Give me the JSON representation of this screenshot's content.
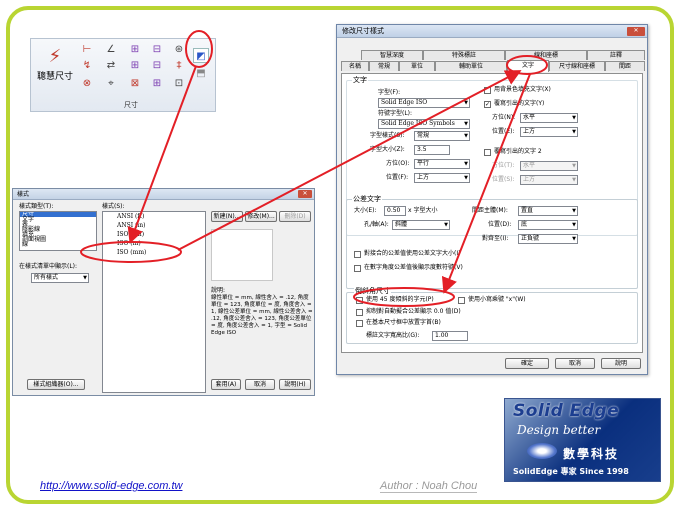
{
  "ribbon": {
    "big_label": "聰慧尺寸",
    "group_label": "尺寸"
  },
  "style_dialog": {
    "title": "樣式",
    "close": "✕",
    "style_type_label": "樣式類型(T):",
    "style_types": [
      "尺寸",
      "文字",
      "表",
      "陰影線",
      "填充",
      "剖面視圖",
      "線"
    ],
    "styles_label": "樣式(S):",
    "styles": [
      "ANSI (ft)",
      "ANSI (in)",
      "ISO (cm)",
      "ISO (m)",
      "ISO (mm)"
    ],
    "show_list_label": "在樣式清單中顯示(L):",
    "show_list_value": "所有樣式",
    "new_button": "新建(N)...",
    "modify_button": "修改(M)...",
    "delete_button": "刪除(D)",
    "description_label": "說明:",
    "description_text": "線性單位 = mm, 線性舍入 = .12, 角度單位 = 123, 角度單位 = 度, 角度舍入 = 1, 線性公差單位 = mm, 線性公差舍入 = .12, 角度公差舍入 = 123, 角度公差單位 = 度, 角度公差舍入 = 1, 字型 = Solid Edge ISO",
    "organizer_button": "樣式組織器(O)...",
    "apply_button": "套用(A)",
    "cancel_button": "取消",
    "help_button": "說明(H)"
  },
  "dim_dialog": {
    "title": "修改尺寸樣式",
    "close": "✕",
    "tabs_row1": [
      "智慧深度",
      "特殊標註",
      "線和座標",
      "註釋"
    ],
    "tabs_row2": [
      "名稱",
      "常規",
      "單位",
      "輔助單位",
      "文字",
      "尺寸線和座標",
      "間距"
    ],
    "text_group": "文字",
    "font_label": "字型(F):",
    "font_value": "Solid Edge ISO",
    "symbol_font_label": "符號字型(L):",
    "symbol_font_value": "Solid Edge ISO Symbols",
    "font_style_label": "字型樣式(S):",
    "font_style_value": "常規",
    "font_size_label": "字型大小(Z):",
    "font_size_value": "3.5",
    "bg_color_label": "用背景色填充文字(X)",
    "override_leader_label": "覆寫引出的文字(Y)",
    "orient1_label": "方位(N):",
    "orient1_value": "水平",
    "pos1_label": "位置(E):",
    "pos1_value": "上方",
    "orient2_label": "方位(O):",
    "orient2_value": "平行",
    "pos2_label": "位置(F):",
    "pos2_value": "上方",
    "override_leader2_label": "覆寫引出的文字 2",
    "orient3_label": "方位(T):",
    "orient3_value": "水平",
    "pos3_label": "位置(S):",
    "pos3_value": "上方",
    "tol_group": "公差文字",
    "tol_size_label": "大小(E):",
    "tol_size_value": "0.50",
    "tol_size_suffix": "x 字型大小",
    "tol_justify_label": "間距主體(M):",
    "tol_justify_value": "置直",
    "hole_label": "孔/軸(A):",
    "hole_value": "斜體",
    "tol_pos_label": "位置(D):",
    "tol_pos_value": "底",
    "align_label": "對齊至(I):",
    "align_value": "正負號",
    "tol_chk1": "對接合的公差值使用公差文字大小(I)",
    "tol_chk2": "在數字角度公差值後顯示度數符號(V)",
    "chamfer_group": "倒斜角尺寸",
    "chamfer_chk1": "使用 45 度傾斜的字元(P)",
    "chamfer_chk2": "使用小寫乘號 \"x\"(W)",
    "chamfer_chk3": "抑制對自動擬合公差顯示 0.0 值(D)",
    "chamfer_chk4": "在基本尺寸框中放置字首(B)",
    "width_ratio_label": "標註文字寬高比(G):",
    "width_ratio_value": "1.00",
    "ok_button": "確定",
    "cancel_button": "取消",
    "help_button": "說明"
  },
  "logo": {
    "line1": "Solid Edge",
    "line2": "Design better",
    "line3": "數學科技",
    "line4": "SolidEdge 專家 Since 1998"
  },
  "footer": {
    "url": "http://www.solid-edge.com.tw",
    "author": "Author : Noah Chou"
  },
  "colors": {
    "frame": "#b9d532",
    "callout": "#e31f26",
    "link": "#1212c8"
  }
}
